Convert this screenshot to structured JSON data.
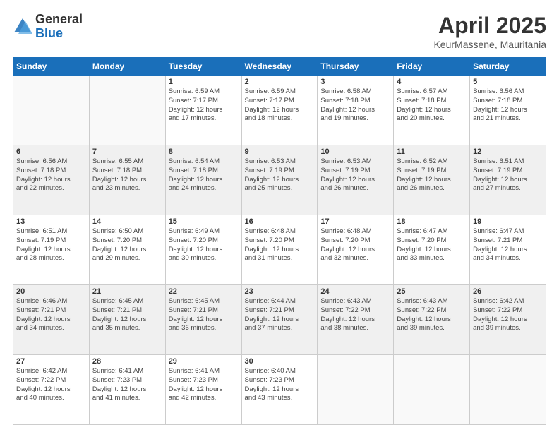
{
  "header": {
    "logo_general": "General",
    "logo_blue": "Blue",
    "title": "April 2025",
    "location": "KeurMassene, Mauritania"
  },
  "days_of_week": [
    "Sunday",
    "Monday",
    "Tuesday",
    "Wednesday",
    "Thursday",
    "Friday",
    "Saturday"
  ],
  "weeks": [
    [
      {
        "day": "",
        "info": ""
      },
      {
        "day": "",
        "info": ""
      },
      {
        "day": "1",
        "info": "Sunrise: 6:59 AM\nSunset: 7:17 PM\nDaylight: 12 hours\nand 17 minutes."
      },
      {
        "day": "2",
        "info": "Sunrise: 6:59 AM\nSunset: 7:17 PM\nDaylight: 12 hours\nand 18 minutes."
      },
      {
        "day": "3",
        "info": "Sunrise: 6:58 AM\nSunset: 7:18 PM\nDaylight: 12 hours\nand 19 minutes."
      },
      {
        "day": "4",
        "info": "Sunrise: 6:57 AM\nSunset: 7:18 PM\nDaylight: 12 hours\nand 20 minutes."
      },
      {
        "day": "5",
        "info": "Sunrise: 6:56 AM\nSunset: 7:18 PM\nDaylight: 12 hours\nand 21 minutes."
      }
    ],
    [
      {
        "day": "6",
        "info": "Sunrise: 6:56 AM\nSunset: 7:18 PM\nDaylight: 12 hours\nand 22 minutes."
      },
      {
        "day": "7",
        "info": "Sunrise: 6:55 AM\nSunset: 7:18 PM\nDaylight: 12 hours\nand 23 minutes."
      },
      {
        "day": "8",
        "info": "Sunrise: 6:54 AM\nSunset: 7:18 PM\nDaylight: 12 hours\nand 24 minutes."
      },
      {
        "day": "9",
        "info": "Sunrise: 6:53 AM\nSunset: 7:19 PM\nDaylight: 12 hours\nand 25 minutes."
      },
      {
        "day": "10",
        "info": "Sunrise: 6:53 AM\nSunset: 7:19 PM\nDaylight: 12 hours\nand 26 minutes."
      },
      {
        "day": "11",
        "info": "Sunrise: 6:52 AM\nSunset: 7:19 PM\nDaylight: 12 hours\nand 26 minutes."
      },
      {
        "day": "12",
        "info": "Sunrise: 6:51 AM\nSunset: 7:19 PM\nDaylight: 12 hours\nand 27 minutes."
      }
    ],
    [
      {
        "day": "13",
        "info": "Sunrise: 6:51 AM\nSunset: 7:19 PM\nDaylight: 12 hours\nand 28 minutes."
      },
      {
        "day": "14",
        "info": "Sunrise: 6:50 AM\nSunset: 7:20 PM\nDaylight: 12 hours\nand 29 minutes."
      },
      {
        "day": "15",
        "info": "Sunrise: 6:49 AM\nSunset: 7:20 PM\nDaylight: 12 hours\nand 30 minutes."
      },
      {
        "day": "16",
        "info": "Sunrise: 6:48 AM\nSunset: 7:20 PM\nDaylight: 12 hours\nand 31 minutes."
      },
      {
        "day": "17",
        "info": "Sunrise: 6:48 AM\nSunset: 7:20 PM\nDaylight: 12 hours\nand 32 minutes."
      },
      {
        "day": "18",
        "info": "Sunrise: 6:47 AM\nSunset: 7:20 PM\nDaylight: 12 hours\nand 33 minutes."
      },
      {
        "day": "19",
        "info": "Sunrise: 6:47 AM\nSunset: 7:21 PM\nDaylight: 12 hours\nand 34 minutes."
      }
    ],
    [
      {
        "day": "20",
        "info": "Sunrise: 6:46 AM\nSunset: 7:21 PM\nDaylight: 12 hours\nand 34 minutes."
      },
      {
        "day": "21",
        "info": "Sunrise: 6:45 AM\nSunset: 7:21 PM\nDaylight: 12 hours\nand 35 minutes."
      },
      {
        "day": "22",
        "info": "Sunrise: 6:45 AM\nSunset: 7:21 PM\nDaylight: 12 hours\nand 36 minutes."
      },
      {
        "day": "23",
        "info": "Sunrise: 6:44 AM\nSunset: 7:21 PM\nDaylight: 12 hours\nand 37 minutes."
      },
      {
        "day": "24",
        "info": "Sunrise: 6:43 AM\nSunset: 7:22 PM\nDaylight: 12 hours\nand 38 minutes."
      },
      {
        "day": "25",
        "info": "Sunrise: 6:43 AM\nSunset: 7:22 PM\nDaylight: 12 hours\nand 39 minutes."
      },
      {
        "day": "26",
        "info": "Sunrise: 6:42 AM\nSunset: 7:22 PM\nDaylight: 12 hours\nand 39 minutes."
      }
    ],
    [
      {
        "day": "27",
        "info": "Sunrise: 6:42 AM\nSunset: 7:22 PM\nDaylight: 12 hours\nand 40 minutes."
      },
      {
        "day": "28",
        "info": "Sunrise: 6:41 AM\nSunset: 7:23 PM\nDaylight: 12 hours\nand 41 minutes."
      },
      {
        "day": "29",
        "info": "Sunrise: 6:41 AM\nSunset: 7:23 PM\nDaylight: 12 hours\nand 42 minutes."
      },
      {
        "day": "30",
        "info": "Sunrise: 6:40 AM\nSunset: 7:23 PM\nDaylight: 12 hours\nand 43 minutes."
      },
      {
        "day": "",
        "info": ""
      },
      {
        "day": "",
        "info": ""
      },
      {
        "day": "",
        "info": ""
      }
    ]
  ]
}
